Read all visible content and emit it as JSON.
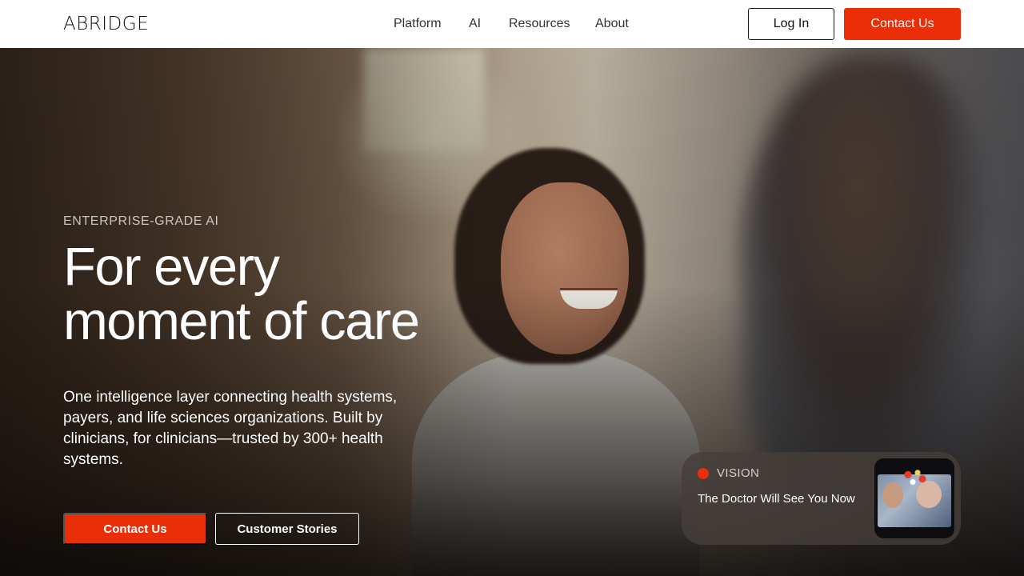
{
  "header": {
    "logo": "ABRIDGE",
    "nav": [
      {
        "label": "Platform"
      },
      {
        "label": "AI"
      },
      {
        "label": "Resources"
      },
      {
        "label": "About"
      }
    ],
    "login_label": "Log In",
    "contact_label": "Contact Us"
  },
  "hero": {
    "eyebrow": "ENTERPRISE-GRADE AI",
    "title_line1": "For every",
    "title_line2": "moment of care",
    "description": "One intelligence layer connecting health systems, payers, and life sciences organizations. Built by clinicians, for clinicians—trusted by 300+ health systems.",
    "primary_cta": "Contact Us",
    "secondary_cta": "Customer Stories"
  },
  "vision_card": {
    "tag": "VISION",
    "title": "The Doctor Will See You Now"
  },
  "colors": {
    "accent": "#ea2e08",
    "text_dark": "#111111",
    "white": "#ffffff"
  }
}
